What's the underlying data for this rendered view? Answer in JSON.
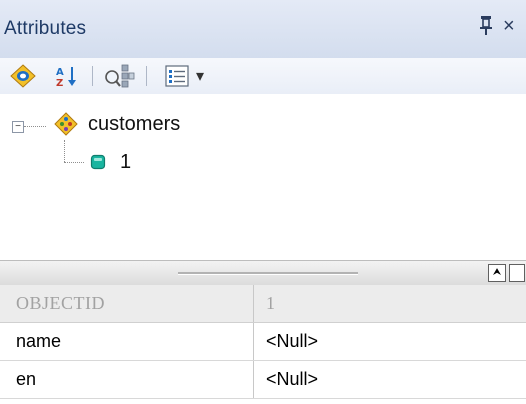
{
  "window": {
    "title": "Attributes",
    "close_glyph": "×"
  },
  "toolbar": {
    "dropdown_glyph": "▾"
  },
  "tree": {
    "expander_glyph": "−",
    "root_label": "customers",
    "child_label": "1"
  },
  "grid": {
    "header": {
      "field": "OBJECTID",
      "value": "1"
    },
    "rows": [
      {
        "field": "name",
        "value": "<Null>"
      },
      {
        "field": "en",
        "value": "<Null>"
      }
    ]
  },
  "splitter": {
    "collapse_glyph": "⮝"
  },
  "colors": {
    "accent": "#1e3a66",
    "node_icon": "#f2c029",
    "feature_icon": "#19b5a0"
  }
}
